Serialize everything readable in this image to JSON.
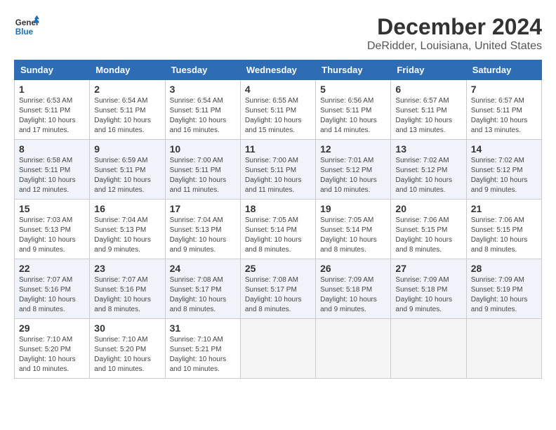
{
  "logo": {
    "line1": "General",
    "line2": "Blue"
  },
  "title": "December 2024",
  "subtitle": "DeRidder, Louisiana, United States",
  "weekdays": [
    "Sunday",
    "Monday",
    "Tuesday",
    "Wednesday",
    "Thursday",
    "Friday",
    "Saturday"
  ],
  "weeks": [
    [
      {
        "day": "1",
        "info": "Sunrise: 6:53 AM\nSunset: 5:11 PM\nDaylight: 10 hours\nand 17 minutes."
      },
      {
        "day": "2",
        "info": "Sunrise: 6:54 AM\nSunset: 5:11 PM\nDaylight: 10 hours\nand 16 minutes."
      },
      {
        "day": "3",
        "info": "Sunrise: 6:54 AM\nSunset: 5:11 PM\nDaylight: 10 hours\nand 16 minutes."
      },
      {
        "day": "4",
        "info": "Sunrise: 6:55 AM\nSunset: 5:11 PM\nDaylight: 10 hours\nand 15 minutes."
      },
      {
        "day": "5",
        "info": "Sunrise: 6:56 AM\nSunset: 5:11 PM\nDaylight: 10 hours\nand 14 minutes."
      },
      {
        "day": "6",
        "info": "Sunrise: 6:57 AM\nSunset: 5:11 PM\nDaylight: 10 hours\nand 13 minutes."
      },
      {
        "day": "7",
        "info": "Sunrise: 6:57 AM\nSunset: 5:11 PM\nDaylight: 10 hours\nand 13 minutes."
      }
    ],
    [
      {
        "day": "8",
        "info": "Sunrise: 6:58 AM\nSunset: 5:11 PM\nDaylight: 10 hours\nand 12 minutes."
      },
      {
        "day": "9",
        "info": "Sunrise: 6:59 AM\nSunset: 5:11 PM\nDaylight: 10 hours\nand 12 minutes."
      },
      {
        "day": "10",
        "info": "Sunrise: 7:00 AM\nSunset: 5:11 PM\nDaylight: 10 hours\nand 11 minutes."
      },
      {
        "day": "11",
        "info": "Sunrise: 7:00 AM\nSunset: 5:11 PM\nDaylight: 10 hours\nand 11 minutes."
      },
      {
        "day": "12",
        "info": "Sunrise: 7:01 AM\nSunset: 5:12 PM\nDaylight: 10 hours\nand 10 minutes."
      },
      {
        "day": "13",
        "info": "Sunrise: 7:02 AM\nSunset: 5:12 PM\nDaylight: 10 hours\nand 10 minutes."
      },
      {
        "day": "14",
        "info": "Sunrise: 7:02 AM\nSunset: 5:12 PM\nDaylight: 10 hours\nand 9 minutes."
      }
    ],
    [
      {
        "day": "15",
        "info": "Sunrise: 7:03 AM\nSunset: 5:13 PM\nDaylight: 10 hours\nand 9 minutes."
      },
      {
        "day": "16",
        "info": "Sunrise: 7:04 AM\nSunset: 5:13 PM\nDaylight: 10 hours\nand 9 minutes."
      },
      {
        "day": "17",
        "info": "Sunrise: 7:04 AM\nSunset: 5:13 PM\nDaylight: 10 hours\nand 9 minutes."
      },
      {
        "day": "18",
        "info": "Sunrise: 7:05 AM\nSunset: 5:14 PM\nDaylight: 10 hours\nand 8 minutes."
      },
      {
        "day": "19",
        "info": "Sunrise: 7:05 AM\nSunset: 5:14 PM\nDaylight: 10 hours\nand 8 minutes."
      },
      {
        "day": "20",
        "info": "Sunrise: 7:06 AM\nSunset: 5:15 PM\nDaylight: 10 hours\nand 8 minutes."
      },
      {
        "day": "21",
        "info": "Sunrise: 7:06 AM\nSunset: 5:15 PM\nDaylight: 10 hours\nand 8 minutes."
      }
    ],
    [
      {
        "day": "22",
        "info": "Sunrise: 7:07 AM\nSunset: 5:16 PM\nDaylight: 10 hours\nand 8 minutes."
      },
      {
        "day": "23",
        "info": "Sunrise: 7:07 AM\nSunset: 5:16 PM\nDaylight: 10 hours\nand 8 minutes."
      },
      {
        "day": "24",
        "info": "Sunrise: 7:08 AM\nSunset: 5:17 PM\nDaylight: 10 hours\nand 8 minutes."
      },
      {
        "day": "25",
        "info": "Sunrise: 7:08 AM\nSunset: 5:17 PM\nDaylight: 10 hours\nand 8 minutes."
      },
      {
        "day": "26",
        "info": "Sunrise: 7:09 AM\nSunset: 5:18 PM\nDaylight: 10 hours\nand 9 minutes."
      },
      {
        "day": "27",
        "info": "Sunrise: 7:09 AM\nSunset: 5:18 PM\nDaylight: 10 hours\nand 9 minutes."
      },
      {
        "day": "28",
        "info": "Sunrise: 7:09 AM\nSunset: 5:19 PM\nDaylight: 10 hours\nand 9 minutes."
      }
    ],
    [
      {
        "day": "29",
        "info": "Sunrise: 7:10 AM\nSunset: 5:20 PM\nDaylight: 10 hours\nand 10 minutes."
      },
      {
        "day": "30",
        "info": "Sunrise: 7:10 AM\nSunset: 5:20 PM\nDaylight: 10 hours\nand 10 minutes."
      },
      {
        "day": "31",
        "info": "Sunrise: 7:10 AM\nSunset: 5:21 PM\nDaylight: 10 hours\nand 10 minutes."
      },
      null,
      null,
      null,
      null
    ]
  ]
}
